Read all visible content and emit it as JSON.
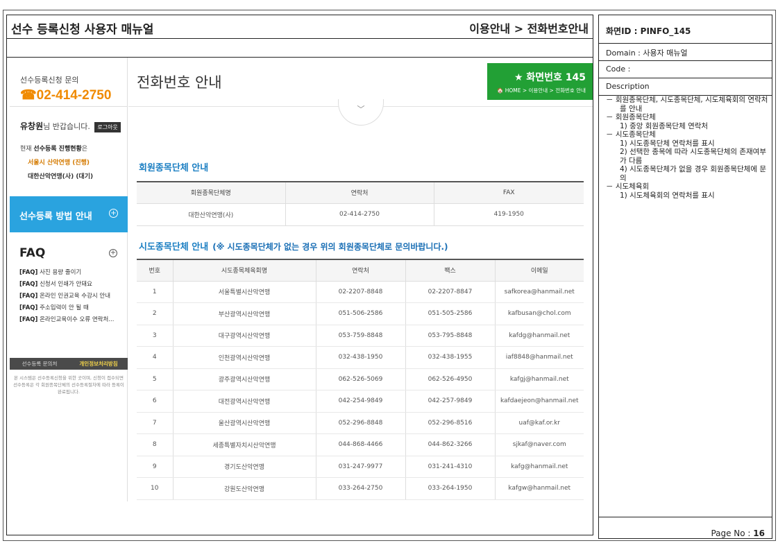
{
  "doc": {
    "title": "선수 등록신청 사용자 매뉴얼",
    "breadcrumb": "이용안내 > 전화번호안내"
  },
  "sidebar": {
    "contact_label": "선수등록신청 문의",
    "phone": "☎02-414-2750",
    "user_name": "유창원",
    "greeting": "님 반갑습니다.",
    "logout_label": "로그아웃",
    "status_prefix": "현재 ",
    "status_bold": "선수등록 진행현황",
    "status_suffix": "은",
    "assoc_active": "서울시 산악연맹 (진행)",
    "assoc_waiting": "대한산악연맹(사) (대기)",
    "guide_label": "선수등록 방법 안내",
    "faq_title": "FAQ",
    "faq_items": [
      {
        "tag": "[FAQ]",
        "text": "사진 용량 줄이기"
      },
      {
        "tag": "[FAQ]",
        "text": "신청서 인쇄가 안돼요"
      },
      {
        "tag": "[FAQ]",
        "text": "온라인 인권교육 수강시 안내"
      },
      {
        "tag": "[FAQ]",
        "text": "주소입력이 안 될 때"
      },
      {
        "tag": "[FAQ]",
        "text": "온라인교육이수 오류 연락처..."
      }
    ],
    "bottom_left": "선수등록 문의처",
    "bottom_right": "개인정보처리방침",
    "note": "본 시스템은 선수등록신청을 위한 곳이며, 신청이 접수되면 선수등록은 각 회원종목단체의 선수등록절차에 따라 등록이 완료됩니다."
  },
  "content": {
    "heading": "전화번호 안내",
    "screen_no": "★ 화면번호 145",
    "screen_crumb": "🏠 HOME > 이용안내 > 전화번호 안내",
    "chevron": "﹀",
    "section1_title": "회원종목단체 안내",
    "table1": {
      "headers": [
        "회원종목단체명",
        "연락처",
        "FAX"
      ],
      "row": [
        "대한산악연맹(사)",
        "02-414-2750",
        "419-1950"
      ]
    },
    "section2_title": "시도종목단체 안내",
    "section2_note": "(※ 시도종목단체가 없는 경우 위의 회원종목단체로 문의바랍니다.)",
    "table2": {
      "headers": [
        "번호",
        "시도종목체육회명",
        "연락처",
        "팩스",
        "이메일"
      ],
      "rows": [
        [
          "1",
          "서울특별시산악연맹",
          "02-2207-8848",
          "02-2207-8847",
          "safkorea@hanmail.net"
        ],
        [
          "2",
          "부산광역시산악연맹",
          "051-506-2586",
          "051-505-2586",
          "kafbusan@chol.com"
        ],
        [
          "3",
          "대구광역시산악연맹",
          "053-759-8848",
          "053-795-8848",
          "kafdg@hanmail.net"
        ],
        [
          "4",
          "인천광역시산악연맹",
          "032-438-1950",
          "032-438-1955",
          "iaf8848@hanmail.net"
        ],
        [
          "5",
          "광주광역시산악연맹",
          "062-526-5069",
          "062-526-4950",
          "kafgj@hanmail.net"
        ],
        [
          "6",
          "대전광역시산악연맹",
          "042-254-9849",
          "042-257-9849",
          "kafdaejeon@hanmail.net"
        ],
        [
          "7",
          "울산광역시산악연맹",
          "052-296-8848",
          "052-296-8516",
          "uaf@kaf.or.kr"
        ],
        [
          "8",
          "세종특별자치시산악연맹",
          "044-868-4466",
          "044-862-3266",
          "sjkaf@naver.com"
        ],
        [
          "9",
          "경기도산악연맹",
          "031-247-9977",
          "031-241-4310",
          "kafg@hanmail.net"
        ],
        [
          "10",
          "강원도산악연맹",
          "033-264-2750",
          "033-264-1950",
          "kafgw@hanmail.net"
        ]
      ]
    }
  },
  "panel": {
    "screen_id": "화면ID : PINFO_145",
    "domain": "Domain : 사용자 매뉴얼",
    "code": "Code :",
    "description_label": "Description",
    "desc": [
      {
        "type": "item",
        "text": "－  회원종목단체, 시도종목단체, 시도체육회의 연락처를 안내"
      },
      {
        "type": "item",
        "text": "－  회원종목단체"
      },
      {
        "type": "sub",
        "text": "1) 중앙 회원종목단체 연락처"
      },
      {
        "type": "item",
        "text": "－  시도종목단체"
      },
      {
        "type": "sub",
        "text": "1) 시도종목단체 연락처를 표시"
      },
      {
        "type": "sub",
        "text": "2) 선택한 종목에 따라 시도종목단체의 존재여부가 다름"
      },
      {
        "type": "sub",
        "text": "4) 시도종목단체가 없을 경우 회원종목단체에 문의"
      },
      {
        "type": "item",
        "text": "－  시도체육회"
      },
      {
        "type": "sub",
        "text": "1) 시도체육회의 연락처를 표시"
      }
    ],
    "page_label": "Page No : ",
    "page_no": "16"
  }
}
